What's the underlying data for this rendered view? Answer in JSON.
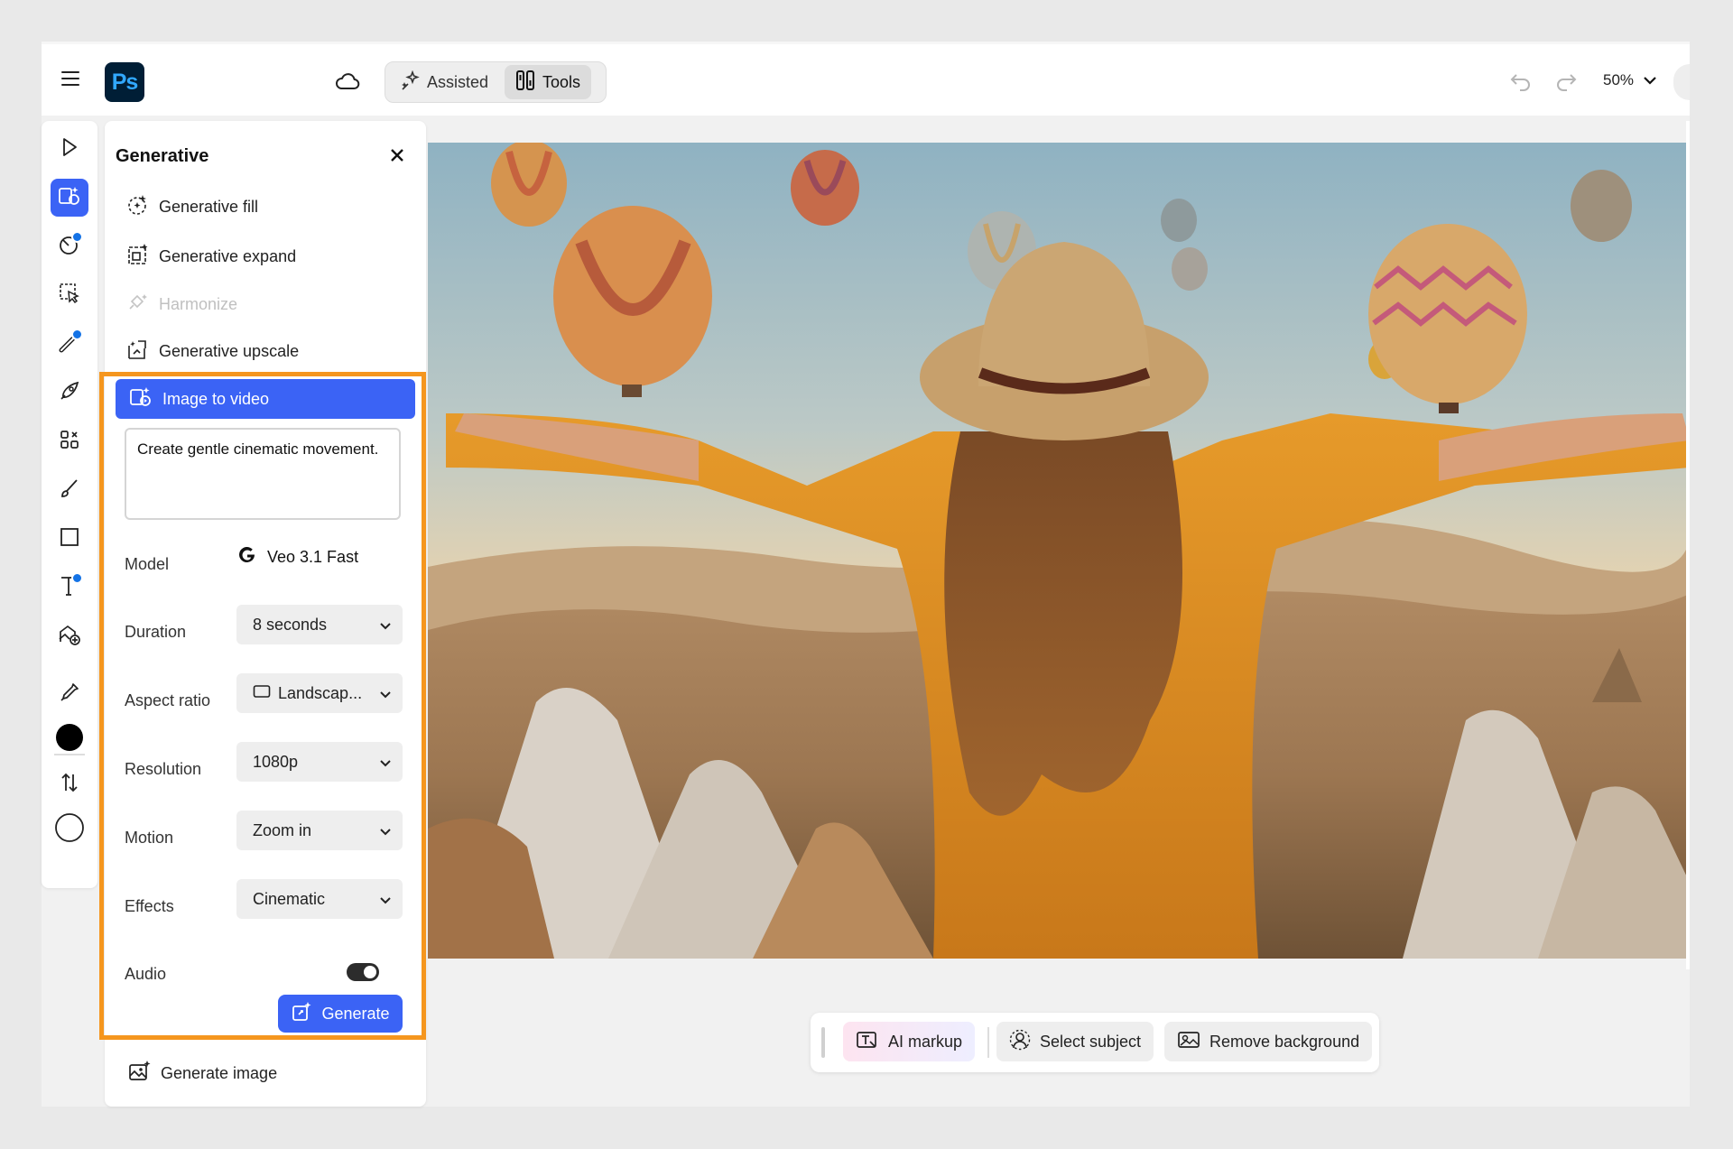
{
  "topbar": {
    "logo_text": "Ps",
    "modes": {
      "assisted_label": "Assisted",
      "tools_label": "Tools",
      "active": "Tools"
    },
    "zoom_level": "50%"
  },
  "toolbar": {
    "tools": [
      "select-icon",
      "generative-tools-icon",
      "adjust-icon",
      "selection-icon",
      "healing-icon",
      "quick-actions-icon",
      "grid-icon",
      "brush-icon",
      "shape-icon",
      "text-icon",
      "image-generate-icon",
      "eyedropper-icon",
      "foreground-color-icon",
      "swap-icon",
      "background-color-icon"
    ],
    "foreground_color": "#000000",
    "background_color": "#ffffff"
  },
  "panel": {
    "title": "Generative",
    "items": [
      {
        "label": "Generative fill",
        "icon": "generative-fill-icon",
        "disabled": false
      },
      {
        "label": "Generative expand",
        "icon": "generative-expand-icon",
        "disabled": false
      },
      {
        "label": "Harmonize",
        "icon": "harmonize-icon",
        "disabled": true
      },
      {
        "label": "Generative upscale",
        "icon": "generative-upscale-icon",
        "disabled": false
      }
    ],
    "image_to_video": {
      "label": "Image to video",
      "prompt": "Create gentle cinematic movement.",
      "model_label": "Model",
      "model_value": "Veo 3.1 Fast",
      "duration_label": "Duration",
      "duration_value": "8 seconds",
      "aspect_label": "Aspect ratio",
      "aspect_value": "Landscap...",
      "resolution_label": "Resolution",
      "resolution_value": "1080p",
      "motion_label": "Motion",
      "motion_value": "Zoom in",
      "effects_label": "Effects",
      "effects_value": "Cinematic",
      "audio_label": "Audio",
      "audio_on": true,
      "generate_label": "Generate"
    },
    "generate_image_label": "Generate image"
  },
  "context_bar": {
    "ai_markup_label": "AI markup",
    "select_subject_label": "Select subject",
    "remove_background_label": "Remove background"
  },
  "colors": {
    "accent": "#3b63f5",
    "highlight": "#f5961e",
    "ps_logo_bg": "#001e36",
    "ps_logo_text": "#31a8ff"
  }
}
